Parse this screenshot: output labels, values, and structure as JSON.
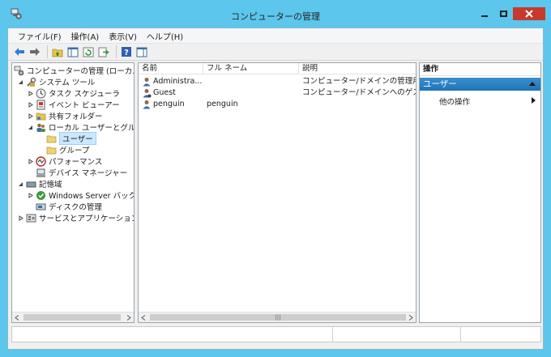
{
  "window": {
    "title": "コンピューターの管理",
    "app_icon": "computer-management-icon",
    "controls": {
      "minimize": "minimize-icon",
      "maximize": "maximize-icon",
      "close": "close-icon"
    }
  },
  "colors": {
    "frame": "#5cc6ec",
    "close": "#c7392a",
    "selection": "#cce8ff",
    "action_header": "#1f74b8"
  },
  "menubar": {
    "items": [
      "ファイル(F)",
      "操作(A)",
      "表示(V)",
      "ヘルプ(H)"
    ]
  },
  "toolbar": {
    "buttons": [
      "back-arrow-icon",
      "forward-arrow-icon",
      "up-folder-icon",
      "show-hide-tree-icon",
      "refresh-icon",
      "export-list-icon",
      "help-icon",
      "show-hide-action-pane-icon"
    ]
  },
  "tree": {
    "items": [
      {
        "label": "コンピューターの管理 (ローカル)",
        "icon": "computer-management-icon",
        "arrow": ""
      },
      {
        "label": "システム ツール",
        "icon": "system-tools-icon",
        "arrow": "expanded"
      },
      {
        "label": "タスク スケジューラ",
        "icon": "clock-icon",
        "arrow": "collapsed"
      },
      {
        "label": "イベント ビューアー",
        "icon": "event-viewer-icon",
        "arrow": "collapsed"
      },
      {
        "label": "共有フォルダー",
        "icon": "shared-folder-icon",
        "arrow": "collapsed"
      },
      {
        "label": "ローカル ユーザーとグループ",
        "icon": "users-groups-icon",
        "arrow": "expanded"
      },
      {
        "label": "ユーザー",
        "icon": "folder-icon",
        "arrow": "",
        "selected": true
      },
      {
        "label": "グループ",
        "icon": "folder-icon",
        "arrow": ""
      },
      {
        "label": "パフォーマンス",
        "icon": "performance-icon",
        "arrow": "collapsed"
      },
      {
        "label": "デバイス マネージャー",
        "icon": "device-manager-icon",
        "arrow": ""
      },
      {
        "label": "記憶域",
        "icon": "storage-icon",
        "arrow": "expanded"
      },
      {
        "label": "Windows Server バックアップ",
        "icon": "backup-icon",
        "arrow": "collapsed"
      },
      {
        "label": "ディスクの管理",
        "icon": "disk-management-icon",
        "arrow": ""
      },
      {
        "label": "サービスとアプリケーション",
        "icon": "services-icon",
        "arrow": "collapsed"
      }
    ]
  },
  "list": {
    "columns": [
      "名前",
      "フル ネーム",
      "説明"
    ],
    "rows": [
      {
        "name": "Administra...",
        "fullname": "",
        "description": "コンピューター/ドメインの管理用 (ビル..."
      },
      {
        "name": "Guest",
        "fullname": "",
        "description": "コンピューター/ドメインへのゲスト アク..."
      },
      {
        "name": "penguin",
        "fullname": "penguin",
        "description": ""
      }
    ]
  },
  "actions": {
    "title": "操作",
    "section": "ユーザー",
    "items": [
      "他の操作"
    ]
  }
}
